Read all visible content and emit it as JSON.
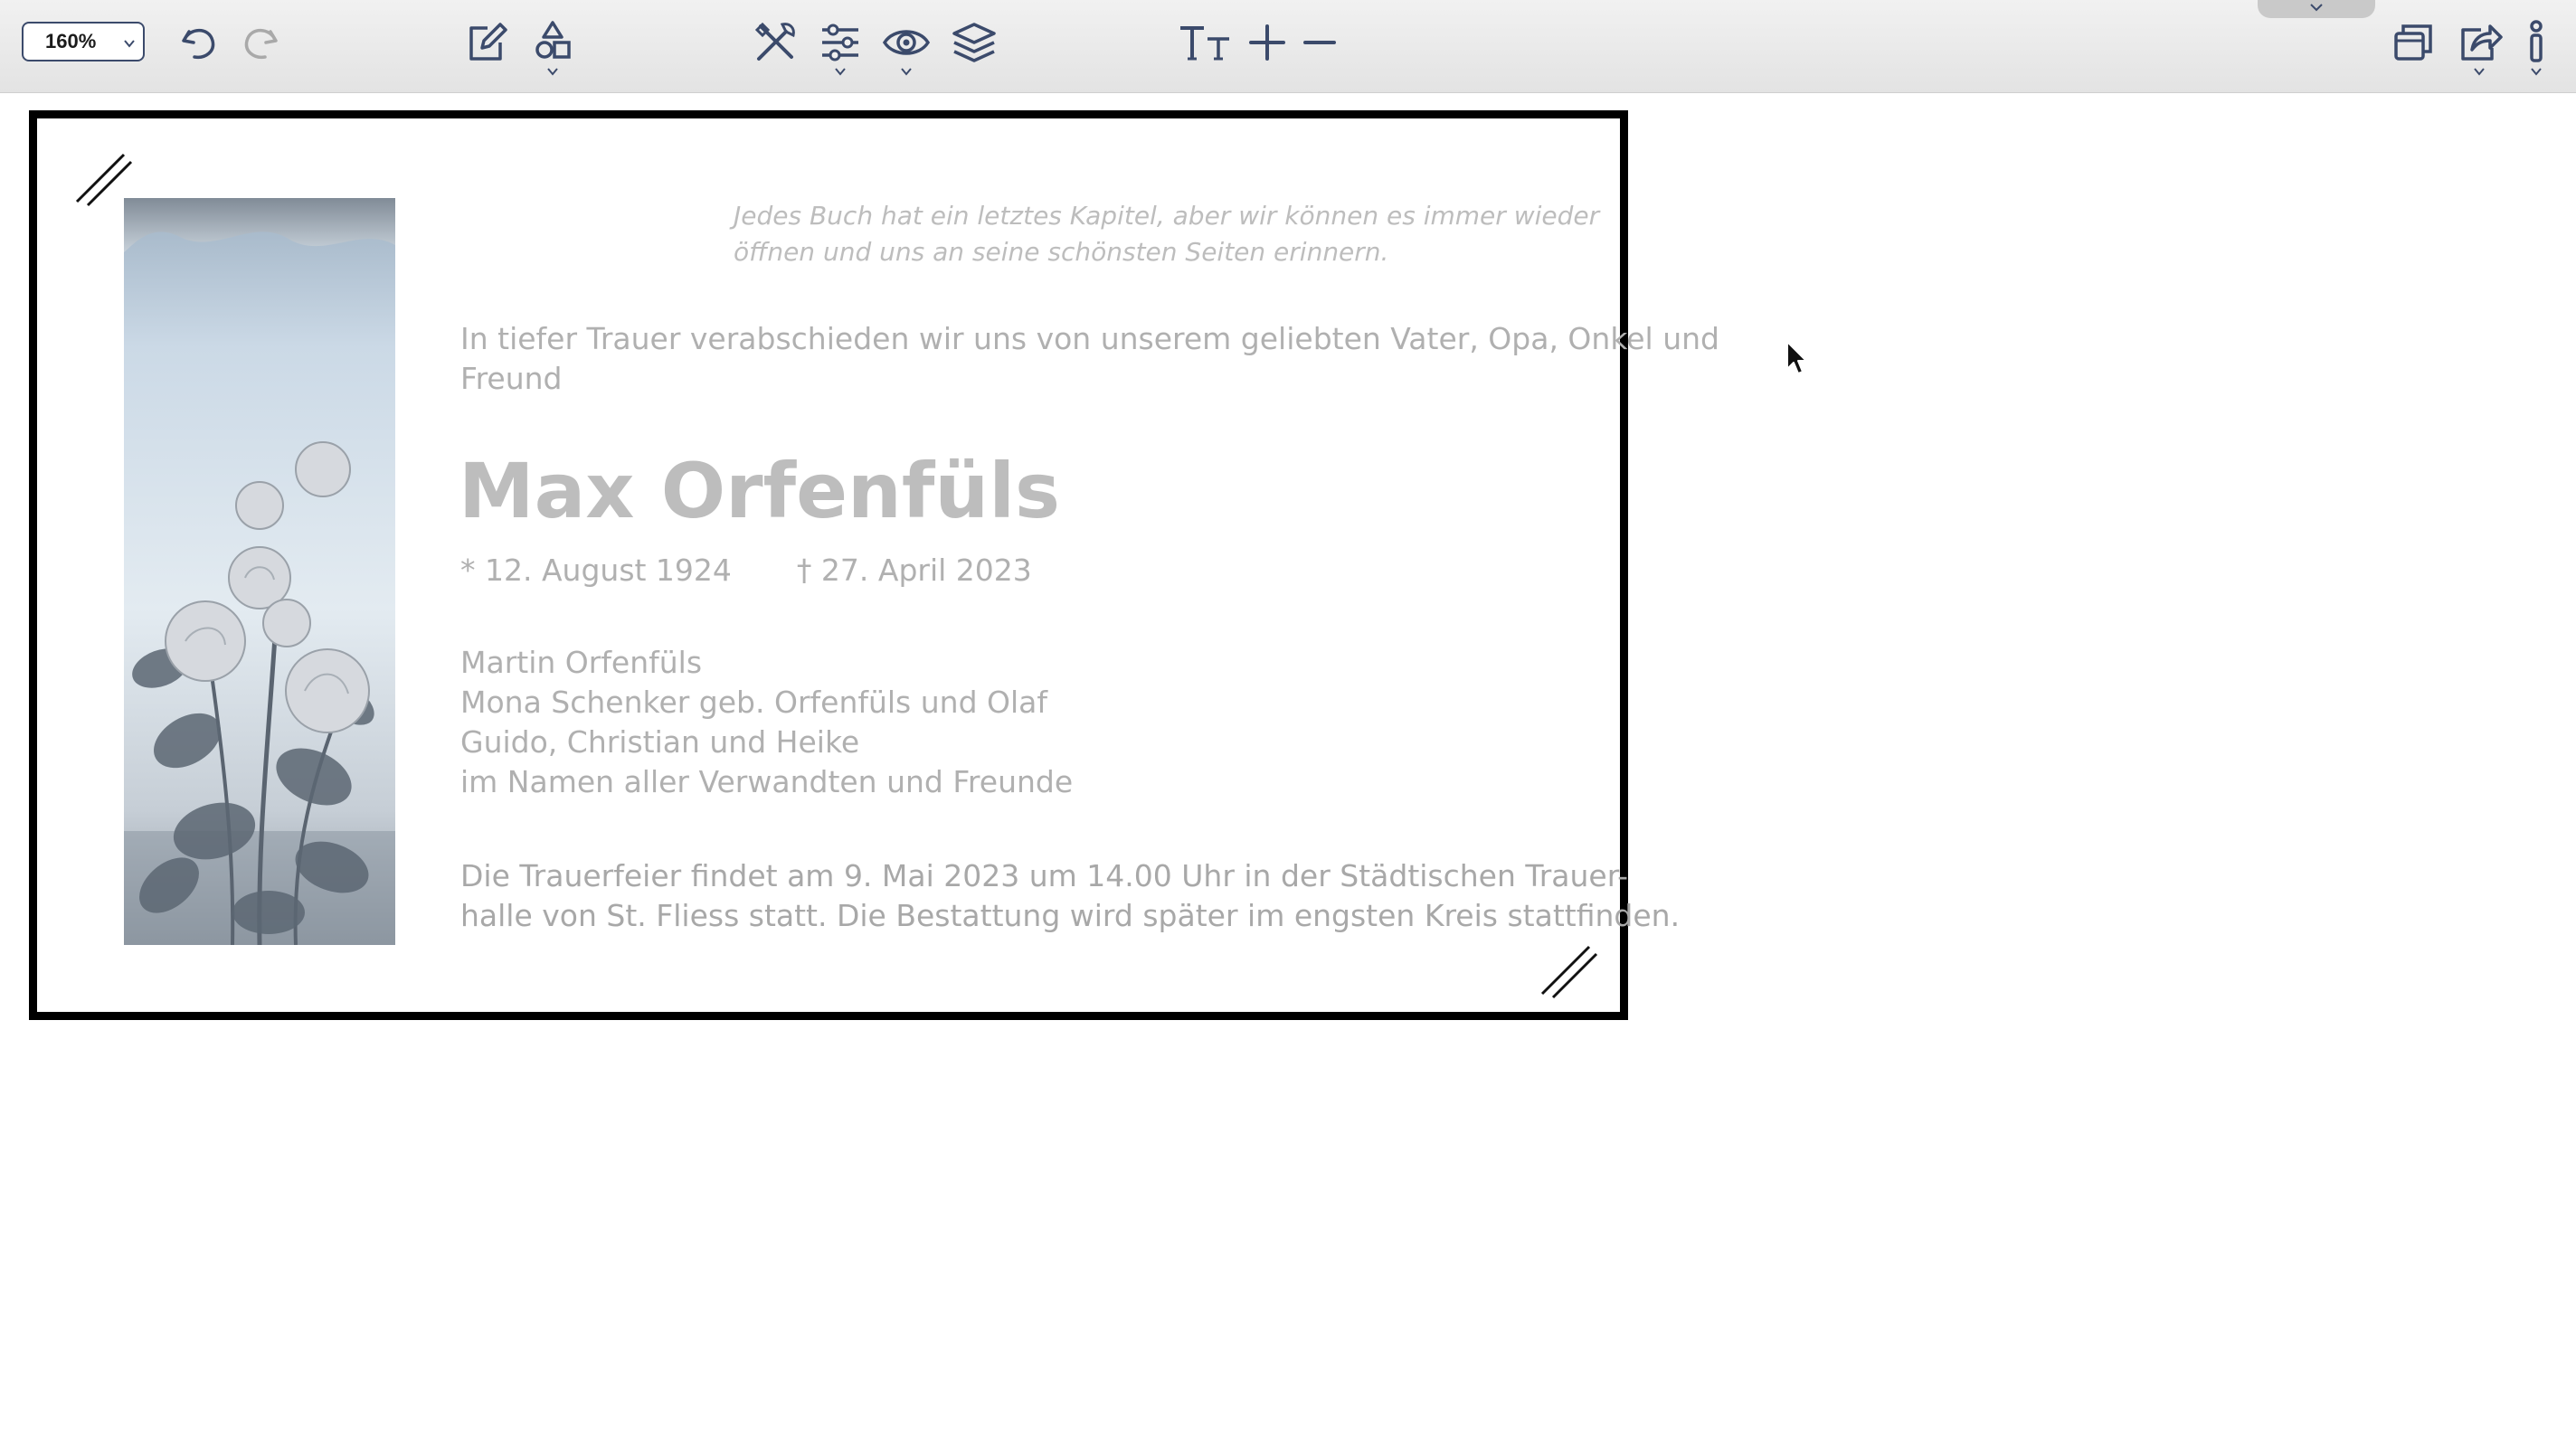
{
  "toolbar": {
    "zoom": "160%",
    "icons": {
      "undo": "undo-icon",
      "redo": "redo-icon",
      "edit": "pencil-square-icon",
      "shapes": "shapes-icon",
      "tools": "tools-icon",
      "adjust": "sliders-icon",
      "view": "eye-icon",
      "layers": "layers-icon",
      "text_size": "text-size-icon",
      "zoom_in": "plus-icon",
      "zoom_out": "minus-icon",
      "windows": "windows-icon",
      "share": "share-icon",
      "info": "info-icon"
    },
    "accent_color": "#3b4a6b"
  },
  "document": {
    "quote_line1": "Jedes Buch hat ein letztes Kapitel, aber wir können es immer wieder",
    "quote_line2": "öffnen und uns an seine schönsten Seiten erinnern.",
    "intro_line1": "In tiefer Trauer verabschieden wir uns von unserem geliebten Vater, Opa, Onkel und",
    "intro_line2": "Freund",
    "name": "Max Orfenfüls",
    "birth": "* 12. August 1924",
    "death": "† 27. April 2023",
    "family": [
      "Martin Orfenfüls",
      "Mona Schenker geb. Orfenfüls und Olaf",
      "Guido, Christian und Heike",
      "im Namen aller Verwandten und Freunde"
    ],
    "ceremony_line1": "Die Trauerfeier findet am 9. Mai 2023 um 14.00 Uhr in der Städtischen Trauer-",
    "ceremony_line2": "halle von St. Fliess statt. Die Bestattung wird später im engsten Kreis stattfinden.",
    "image": "roses-photo"
  }
}
